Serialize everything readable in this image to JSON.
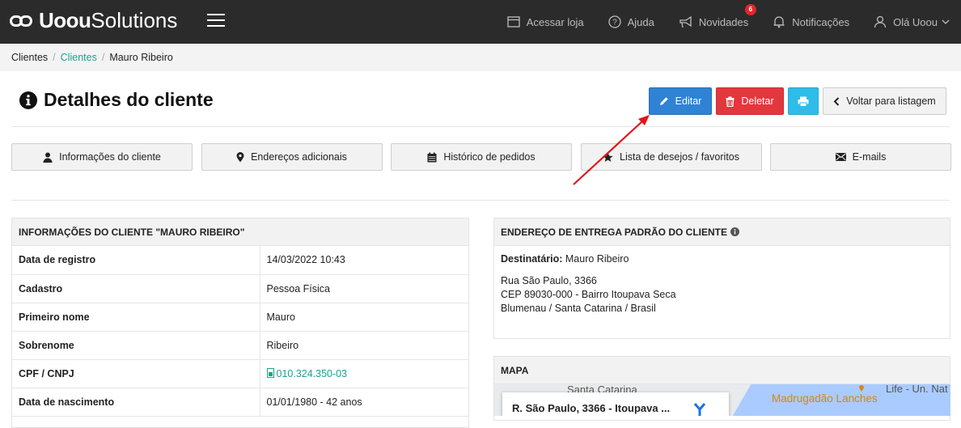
{
  "header": {
    "brand_bold": "Uoou",
    "brand_light": "Solutions",
    "nav": [
      {
        "label": "Acessar loja",
        "icon": "store-icon"
      },
      {
        "label": "Ajuda",
        "icon": "help-icon"
      },
      {
        "label": "Novidades",
        "icon": "megaphone-icon",
        "badge": "6"
      },
      {
        "label": "Notificações",
        "icon": "bell-icon"
      },
      {
        "label": "Olá Uoou",
        "icon": "user-icon"
      }
    ]
  },
  "breadcrumb": [
    "Clientes",
    "Clientes",
    "Mauro Ribeiro"
  ],
  "page": {
    "title": "Detalhes do cliente",
    "buttons": {
      "edit": "Editar",
      "delete": "Deletar",
      "back": "Voltar para listagem"
    }
  },
  "tabs": [
    {
      "label": "Informações do cliente",
      "icon": "user-icon"
    },
    {
      "label": "Endereços adicionais",
      "icon": "map-pin-icon"
    },
    {
      "label": "Histórico de pedidos",
      "icon": "calendar-icon"
    },
    {
      "label": "Lista de desejos / favoritos",
      "icon": "star-icon"
    },
    {
      "label": "E-mails",
      "icon": "envelope-icon"
    }
  ],
  "client_info": {
    "heading": "INFORMAÇÕES DO CLIENTE \"MAURO RIBEIRO\"",
    "rows": [
      {
        "label": "Data de registro",
        "value": "14/03/2022 10:43"
      },
      {
        "label": "Cadastro",
        "value": "Pessoa Física"
      },
      {
        "label": "Primeiro nome",
        "value": "Mauro"
      },
      {
        "label": "Sobrenome",
        "value": "Ribeiro"
      },
      {
        "label": "CPF / CNPJ",
        "value": "010.324.350-03"
      },
      {
        "label": "Data de nascimento",
        "value": "01/01/1980 - 42 anos"
      }
    ]
  },
  "delivery": {
    "heading": "ENDEREÇO DE ENTREGA PADRÃO DO CLIENTE",
    "recipient_label": "Destinatário:",
    "recipient": "Mauro Ribeiro",
    "line1": "Rua São Paulo, 3366",
    "line2": "CEP 89030-000 - Bairro Itoupava Seca",
    "line3": "Blumenau / Santa Catarina / Brasil"
  },
  "map": {
    "heading": "MAPA",
    "card_title": "R. São Paulo, 3366 - Itoupava ...",
    "label_street": "Santa Catarina",
    "poi": "Madrugadão Lanches",
    "label_right": "Life - Un. Nat"
  },
  "colors": {
    "accent": "#1aa38b",
    "edit": "#2f82d4",
    "delete": "#e3373e",
    "print": "#2ebde8",
    "annotation": "#e0161b"
  }
}
